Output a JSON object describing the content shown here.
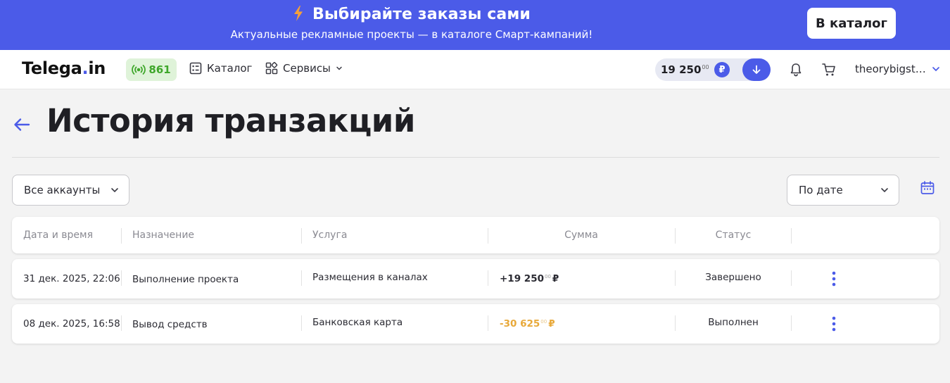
{
  "promo": {
    "title": "Выбирайте заказы сами",
    "subtitle": "Актуальные рекламные проекты — в каталоге Смарт-кампаний!",
    "cta": "В каталог"
  },
  "nav": {
    "logo_main": "Telega",
    "logo_dot": ".",
    "logo_tld": "in",
    "online_count": "861",
    "catalog": "Каталог",
    "services": "Сервисы",
    "balance": "19 250",
    "balance_cents": "00",
    "currency": "₽",
    "username": "theorybigst…"
  },
  "page": {
    "title": "История транзакций"
  },
  "filters": {
    "accounts": "Все аккаунты",
    "sort": "По дате"
  },
  "table": {
    "headers": [
      "Дата и время",
      "Назначение",
      "Услуга",
      "Сумма",
      "Статус"
    ],
    "rows": [
      {
        "date": "31 дек. 2025, 22:06",
        "purpose": "Выполнение проекта",
        "service": "Размещения в каналах",
        "amount": "+19 250",
        "cents": "00",
        "currency": "₽",
        "status": "Завершено"
      },
      {
        "date": "08 дек. 2025, 16:58",
        "purpose": "Вывод средств",
        "service": "Банковская карта",
        "amount": "-30 625",
        "cents": "00",
        "currency": "₽",
        "status": "Выполнен"
      }
    ]
  },
  "colors": {
    "accent": "#4b5be8",
    "online_green": "#3fa72b",
    "negative_amount": "#e8a93a"
  }
}
